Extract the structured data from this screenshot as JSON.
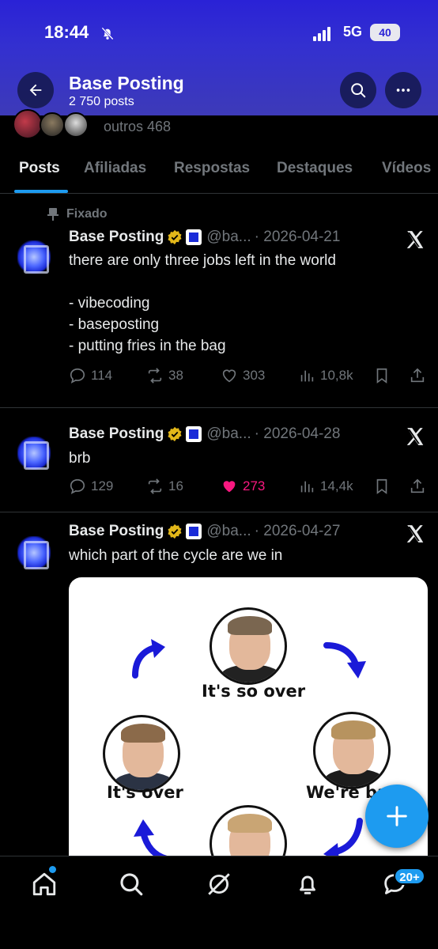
{
  "status_bar": {
    "time": "18:44",
    "network": "5G",
    "battery": "40"
  },
  "header": {
    "title": "Base Posting",
    "post_count": "2 750 posts"
  },
  "followers": {
    "text": "outros 468"
  },
  "tabs": [
    {
      "label": "Posts",
      "active": true
    },
    {
      "label": "Afiliadas",
      "active": false
    },
    {
      "label": "Respostas",
      "active": false
    },
    {
      "label": "Destaques",
      "active": false
    },
    {
      "label": "Vídeos",
      "active": false
    }
  ],
  "posts": [
    {
      "pinned_label": "Fixado",
      "author": "Base Posting",
      "handle": "@ba...",
      "date": "· 2026-04-21",
      "text": "there are only three jobs left in the world\n\n- vibecoding\n- baseposting\n- putting fries in the bag",
      "replies": "114",
      "reposts": "38",
      "likes": "303",
      "views": "10,8k",
      "liked": false
    },
    {
      "author": "Base Posting",
      "handle": "@ba...",
      "date": "· 2026-04-28",
      "text": "brb",
      "replies": "129",
      "reposts": "16",
      "likes": "273",
      "views": "14,4k",
      "liked": true
    },
    {
      "author": "Base Posting",
      "handle": "@ba...",
      "date": "· 2026-04-27",
      "text": "which part of the cycle are we in",
      "media": {
        "labels": {
          "top": "It's so over",
          "left": "It's over",
          "right": "We're ba"
        }
      }
    }
  ],
  "nav": {
    "messages_badge": "20+"
  },
  "colors": {
    "accent": "#1d9bf0",
    "like": "#f91880",
    "header": "#3330d0"
  }
}
